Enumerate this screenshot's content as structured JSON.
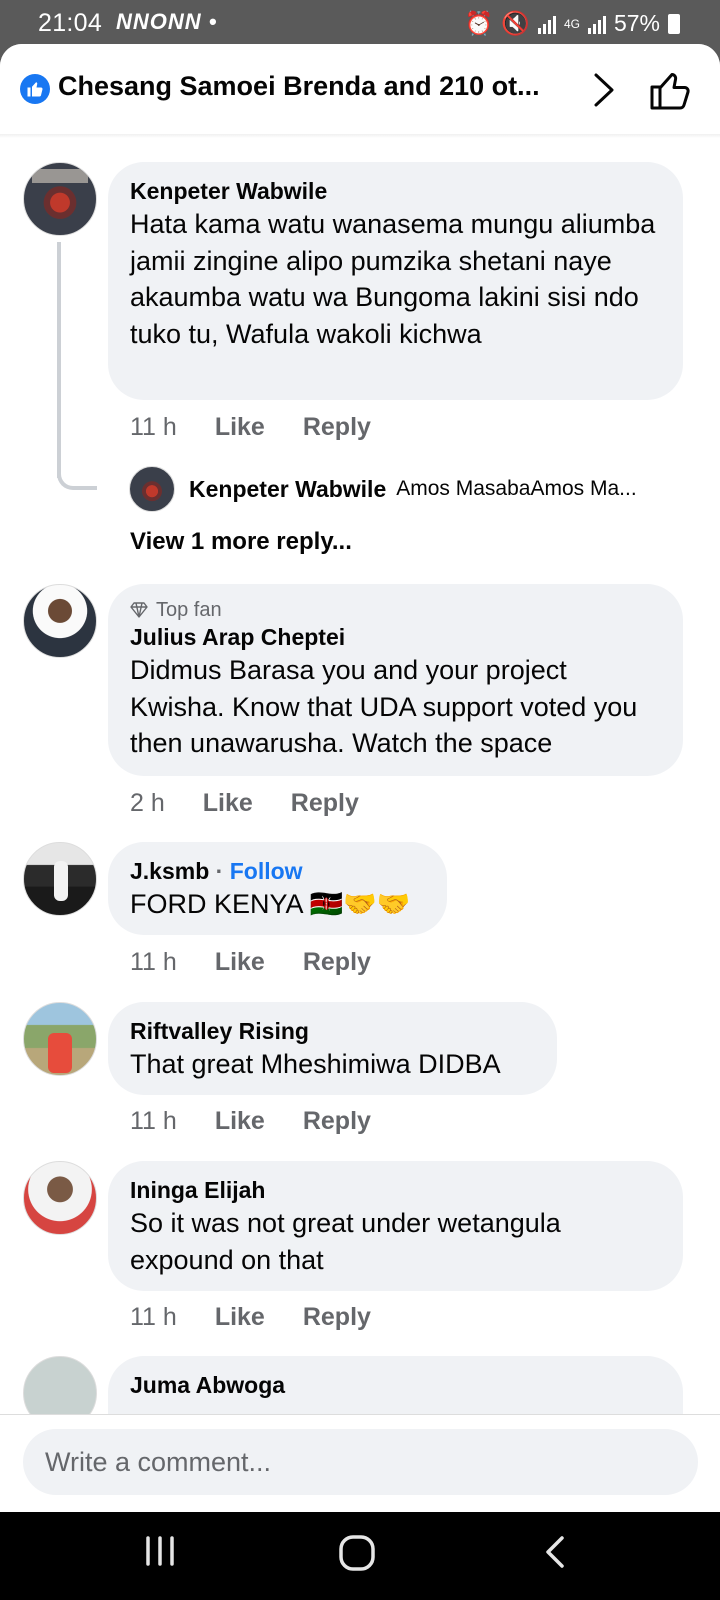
{
  "status_bar": {
    "time": "21:04",
    "notification_icons": "NNONN •",
    "battery": "57%"
  },
  "header": {
    "title": "Chesang Samoei Brenda and 210 ot...",
    "accent": "#1877f2"
  },
  "comments": [
    {
      "name": "Kenpeter Wabwile",
      "text": "Hata kama watu wanasema mungu aliumba jamii zingine alipo pumzika shetani naye akaumba watu wa Bungoma  lakini sisi ndo tuko tu, Wafula wakoli kichwa",
      "time": "11 h",
      "like": "Like",
      "reply": "Reply",
      "replies": {
        "preview_name": "Kenpeter Wabwile",
        "preview_text": "Amos MasabaAmos Ma...",
        "view_more": "View 1 more reply..."
      }
    },
    {
      "badge": "Top fan",
      "name": "Julius Arap Cheptei",
      "text": "Didmus Barasa you and your project Kwisha. Know that UDA support voted you then unawarusha. Watch the space",
      "time": "2 h",
      "like": "Like",
      "reply": "Reply"
    },
    {
      "name": "J.ksmb",
      "follow": "Follow",
      "text": "FORD KENYA 🇰🇪🤝🤝",
      "time": "11 h",
      "like": "Like",
      "reply": "Reply"
    },
    {
      "name": "Riftvalley Rising",
      "text": "That great Mheshimiwa DIDBA",
      "time": "11 h",
      "like": "Like",
      "reply": "Reply"
    },
    {
      "name": "Ininga Elijah",
      "text": "So it was not great under wetangula expound on that",
      "time": "11 h",
      "like": "Like",
      "reply": "Reply"
    },
    {
      "name": "Juma Abwoga"
    }
  ],
  "composer": {
    "placeholder": "Write a comment..."
  }
}
